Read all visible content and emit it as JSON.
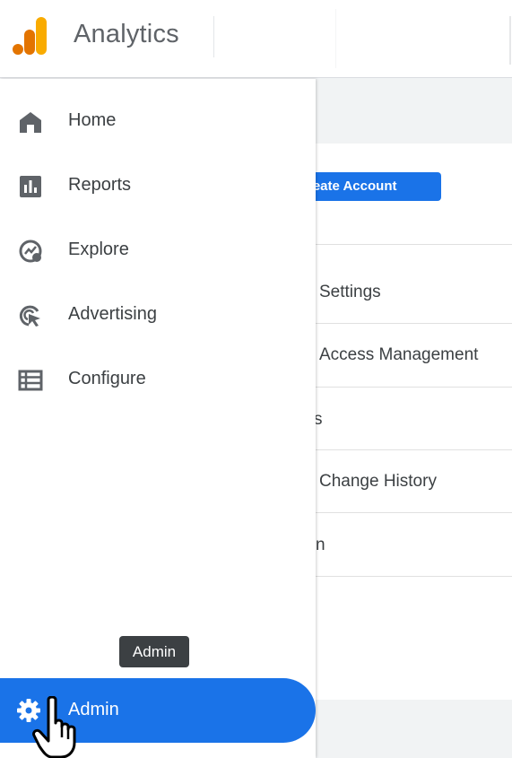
{
  "header": {
    "title": "Analytics"
  },
  "content": {
    "create_button": "reate Account",
    "rows": [
      "Settings",
      "Access Management",
      "s",
      "Change History",
      "n"
    ]
  },
  "drawer": {
    "items": [
      {
        "label": "Home",
        "icon": "home-icon"
      },
      {
        "label": "Reports",
        "icon": "reports-icon"
      },
      {
        "label": "Explore",
        "icon": "explore-icon"
      },
      {
        "label": "Advertising",
        "icon": "advertising-icon"
      },
      {
        "label": "Configure",
        "icon": "configure-icon"
      }
    ],
    "admin": {
      "label": "Admin",
      "icon": "gear-icon"
    },
    "tooltip": "Admin"
  },
  "colors": {
    "accent": "#1a73e8",
    "logo_orange": "#f9ab00",
    "logo_dark_orange": "#e37400",
    "icon_gray": "#5f6368",
    "tooltip_bg": "#3c4043"
  }
}
